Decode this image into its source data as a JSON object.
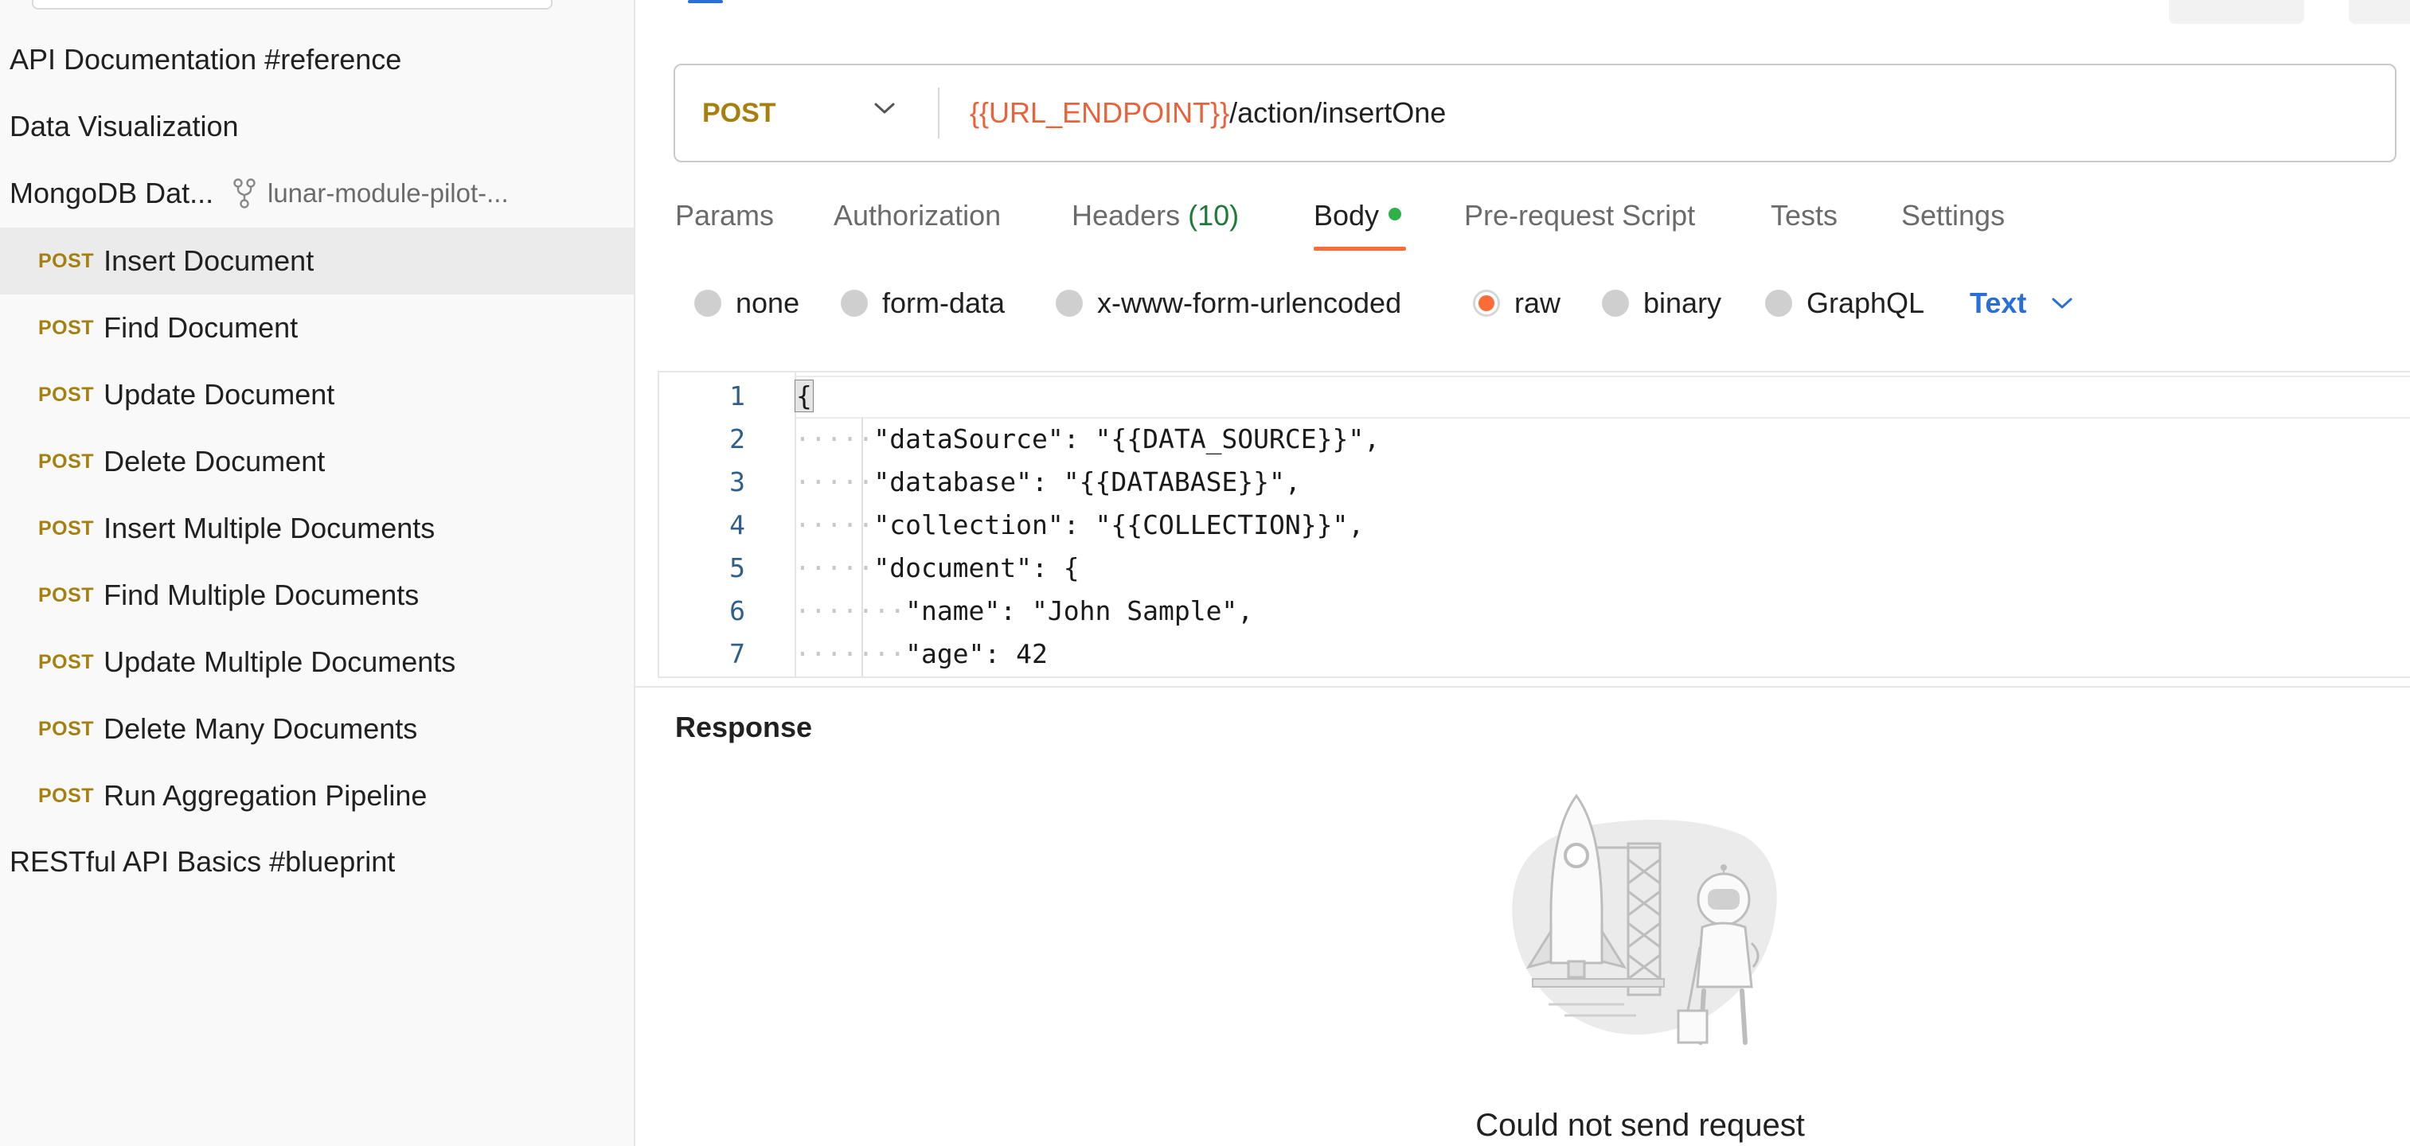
{
  "sidebar": {
    "collections": [
      {
        "label": "API Documentation #reference"
      },
      {
        "label": "Data Visualization"
      },
      {
        "label": "RESTful API Basics #blueprint"
      }
    ],
    "mongo": {
      "label": "MongoDB Dat...",
      "fork_label": "lunar-module-pilot-..."
    },
    "requests": [
      {
        "method": "POST",
        "name": "Insert Document"
      },
      {
        "method": "POST",
        "name": "Find Document"
      },
      {
        "method": "POST",
        "name": "Update Document"
      },
      {
        "method": "POST",
        "name": "Delete Document"
      },
      {
        "method": "POST",
        "name": "Insert Multiple Documents"
      },
      {
        "method": "POST",
        "name": "Find Multiple Documents"
      },
      {
        "method": "POST",
        "name": "Update Multiple Documents"
      },
      {
        "method": "POST",
        "name": "Delete Many Documents"
      },
      {
        "method": "POST",
        "name": "Run Aggregation Pipeline"
      }
    ]
  },
  "request": {
    "method": "POST",
    "url_variable": "{{URL_ENDPOINT}}",
    "url_path": "/action/insertOne"
  },
  "tabs": {
    "params": "Params",
    "authorization": "Authorization",
    "headers": "Headers",
    "headers_count": "(10)",
    "body": "Body",
    "prerequest": "Pre-request Script",
    "tests": "Tests",
    "settings": "Settings"
  },
  "body_types": {
    "none": "none",
    "form_data": "form-data",
    "urlencoded": "x-www-form-urlencoded",
    "raw": "raw",
    "binary": "binary",
    "graphql": "GraphQL",
    "language": "Text"
  },
  "editor": {
    "lines": [
      {
        "n": "1",
        "text": "{"
      },
      {
        "n": "2",
        "text": "\"dataSource\": \"{{DATA_SOURCE}}\","
      },
      {
        "n": "3",
        "text": "\"database\": \"{{DATABASE}}\","
      },
      {
        "n": "4",
        "text": "\"collection\": \"{{COLLECTION}}\","
      },
      {
        "n": "5",
        "text": "\"document\": {"
      },
      {
        "n": "6",
        "text": "\"name\": \"John Sample\","
      },
      {
        "n": "7",
        "text": "\"age\": 42"
      }
    ]
  },
  "response": {
    "title": "Response",
    "message": "Could not send request"
  },
  "colors": {
    "method": "#a5800f",
    "accent": "#ff6c37",
    "variable": "#e8633a",
    "link": "#2a6fd6",
    "status_dot": "#2fb14a"
  }
}
